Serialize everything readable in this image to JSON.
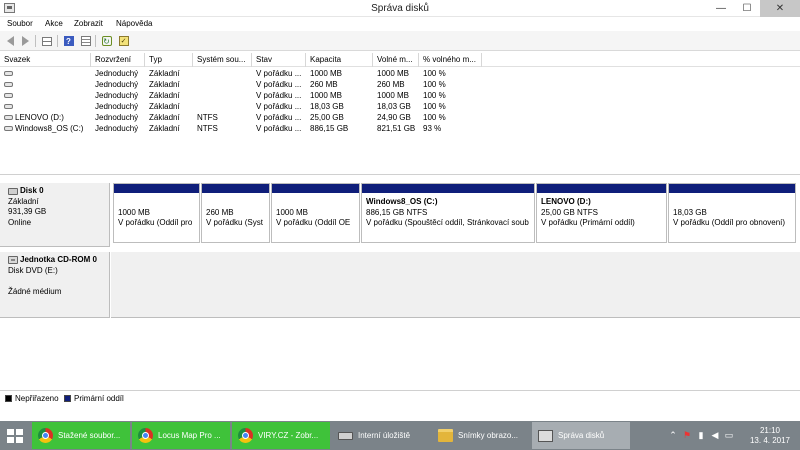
{
  "window": {
    "title": "Správa disků",
    "minimize_glyph": "—",
    "maximize_glyph": "☐",
    "close_glyph": "✕"
  },
  "menu": [
    "Soubor",
    "Akce",
    "Zobrazit",
    "Nápověda"
  ],
  "toolbar": {
    "icons": [
      "back-arrow-icon",
      "forward-arrow-icon",
      "console-tree-icon",
      "help-icon",
      "properties-list-icon",
      "refresh-icon",
      "check-disks-icon"
    ],
    "help_glyph": "?",
    "refresh_glyph": "↻",
    "check_glyph": "✓"
  },
  "volume_table": {
    "columns": [
      "Svazek",
      "Rozvržení",
      "Typ",
      "Systém sou...",
      "Stav",
      "Kapacita",
      "Volné m...",
      "% volného m..."
    ],
    "rows": [
      {
        "volume": "",
        "layout": "Jednoduchý",
        "type": "Základní",
        "fs": "",
        "status": "V pořádku ...",
        "capacity": "1000 MB",
        "free": "1000 MB",
        "pct": "100 %"
      },
      {
        "volume": "",
        "layout": "Jednoduchý",
        "type": "Základní",
        "fs": "",
        "status": "V pořádku ...",
        "capacity": "260 MB",
        "free": "260 MB",
        "pct": "100 %"
      },
      {
        "volume": "",
        "layout": "Jednoduchý",
        "type": "Základní",
        "fs": "",
        "status": "V pořádku ...",
        "capacity": "1000 MB",
        "free": "1000 MB",
        "pct": "100 %"
      },
      {
        "volume": "",
        "layout": "Jednoduchý",
        "type": "Základní",
        "fs": "",
        "status": "V pořádku ...",
        "capacity": "18,03 GB",
        "free": "18,03 GB",
        "pct": "100 %"
      },
      {
        "volume": "LENOVO (D:)",
        "layout": "Jednoduchý",
        "type": "Základní",
        "fs": "NTFS",
        "status": "V pořádku ...",
        "capacity": "25,00 GB",
        "free": "24,90 GB",
        "pct": "100 %"
      },
      {
        "volume": "Windows8_OS (C:)",
        "layout": "Jednoduchý",
        "type": "Základní",
        "fs": "NTFS",
        "status": "V pořádku ...",
        "capacity": "886,15 GB",
        "free": "821,51 GB",
        "pct": "93 %"
      }
    ]
  },
  "disk0": {
    "name": "Disk 0",
    "type": "Základní",
    "size": "931,39 GB",
    "status": "Online",
    "partitions": [
      {
        "name": "",
        "size": "1000 MB",
        "status": "V pořádku (Oddíl pro"
      },
      {
        "name": "",
        "size": "260 MB",
        "status": "V pořádku (Syst"
      },
      {
        "name": "",
        "size": "1000 MB",
        "status": "V pořádku (Oddíl OE"
      },
      {
        "name": "Windows8_OS  (C:)",
        "size": "886,15 GB NTFS",
        "status": "V pořádku (Spouštěcí oddíl, Stránkovací soub"
      },
      {
        "name": "LENOVO  (D:)",
        "size": "25,00 GB NTFS",
        "status": "V pořádku (Primární oddíl)"
      },
      {
        "name": "",
        "size": "18,03 GB",
        "status": "V pořádku (Oddíl pro obnovení)"
      }
    ]
  },
  "cdrom0": {
    "name": "Jednotka CD-ROM 0",
    "type": "Disk DVD (E:)",
    "status": "Žádné médium"
  },
  "legend": [
    {
      "label": "Nepřiřazeno",
      "color": "#000000"
    },
    {
      "label": "Primární oddíl",
      "color": "#0f1e7a"
    }
  ],
  "taskbar": {
    "tasks": [
      {
        "label": "Stažené soubor...",
        "icon": "chrome-icon"
      },
      {
        "label": "Locus Map Pro ...",
        "icon": "chrome-icon"
      },
      {
        "label": "VIRY.CZ - Zobr...",
        "icon": "chrome-icon"
      },
      {
        "label": "Interní úložiště",
        "icon": "drive-icon"
      },
      {
        "label": "Snímky obrazo...",
        "icon": "folder-icon"
      },
      {
        "label": "Správa disků",
        "icon": "disk-management-icon"
      }
    ],
    "tray_icons": [
      "tray-chevron-icon",
      "tray-flag-icon",
      "tray-network-icon",
      "tray-volume-icon",
      "tray-keyboard-icon"
    ],
    "tray_glyphs": [
      "⌃",
      "⚑",
      "▮",
      "◀",
      "▭"
    ],
    "time": "21:10",
    "date": "13. 4. 2017"
  },
  "colors": {
    "primary_partition": "#0f1e7a",
    "taskbar": "#7b8389",
    "chrome_task": "#3fc23a"
  }
}
